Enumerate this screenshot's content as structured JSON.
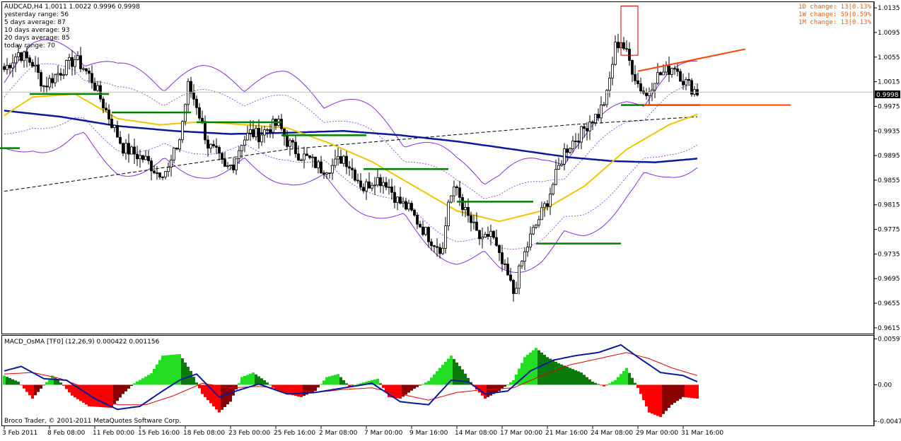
{
  "chart_data": [
    {
      "type": "candlestick",
      "title": "AUDCAD,H4  1.0011 1.0022 0.9996 0.9998",
      "info_lines": [
        "yesterday range: 56",
        "5 days average: 87",
        "10 days average: 93",
        "20 days average: 85",
        "today range: 70"
      ],
      "changes": [
        "1D change: 13|0.13%",
        "1W change: 59|0.59%",
        "1M change: 13|0.13%"
      ],
      "ylim": [
        0.9608,
        1.0142
      ],
      "yticks": [
        "1.0135",
        "1.0095",
        "1.0055",
        "1.0015",
        "0.9975",
        "0.9935",
        "0.9895",
        "0.9855",
        "0.9815",
        "0.9775",
        "0.9735",
        "0.9695",
        "0.9655",
        "0.9615"
      ],
      "current_price": "0.9998",
      "bar_count": 246,
      "anchors": [
        [
          0,
          1.0035
        ],
        [
          5,
          1.0062
        ],
        [
          10,
          1.0045
        ],
        [
          14,
          1.0008
        ],
        [
          18,
          1.0025
        ],
        [
          22,
          1.004
        ],
        [
          25,
          1.0052
        ],
        [
          28,
          1.0038
        ],
        [
          31,
          1.0018
        ],
        [
          34,
          0.9988
        ],
        [
          38,
          0.9948
        ],
        [
          42,
          0.9908
        ],
        [
          46,
          0.9898
        ],
        [
          50,
          0.9888
        ],
        [
          54,
          0.9868
        ],
        [
          58,
          0.9872
        ],
        [
          62,
          0.9922
        ],
        [
          65,
          1.0008
        ],
        [
          68,
          0.9978
        ],
        [
          72,
          0.9912
        ],
        [
          75,
          0.9898
        ],
        [
          78,
          0.9872
        ],
        [
          81,
          0.9882
        ],
        [
          84,
          0.9918
        ],
        [
          87,
          0.9932
        ],
        [
          90,
          0.9928
        ],
        [
          94,
          0.9942
        ],
        [
          97,
          0.9946
        ],
        [
          100,
          0.9918
        ],
        [
          104,
          0.9898
        ],
        [
          108,
          0.9888
        ],
        [
          112,
          0.9874
        ],
        [
          116,
          0.9878
        ],
        [
          120,
          0.9894
        ],
        [
          123,
          0.9872
        ],
        [
          127,
          0.9842
        ],
        [
          131,
          0.9858
        ],
        [
          135,
          0.9852
        ],
        [
          139,
          0.9822
        ],
        [
          143,
          0.9808
        ],
        [
          147,
          0.9782
        ],
        [
          151,
          0.9758
        ],
        [
          155,
          0.9742
        ],
        [
          157,
          0.9822
        ],
        [
          160,
          0.9842
        ],
        [
          163,
          0.9802
        ],
        [
          166,
          0.9778
        ],
        [
          169,
          0.9752
        ],
        [
          172,
          0.9772
        ],
        [
          175,
          0.9728
        ],
        [
          178,
          0.9698
        ],
        [
          180,
          0.9672
        ],
        [
          183,
          0.9722
        ],
        [
          186,
          0.9762
        ],
        [
          189,
          0.9792
        ],
        [
          192,
          0.9822
        ],
        [
          195,
          0.9862
        ],
        [
          198,
          0.9902
        ],
        [
          201,
          0.9918
        ],
        [
          204,
          0.9932
        ],
        [
          207,
          0.9952
        ],
        [
          210,
          0.9962
        ],
        [
          213,
          0.9992
        ],
        [
          216,
          1.0072
        ],
        [
          218,
          1.0082
        ],
        [
          221,
          1.0048
        ],
        [
          224,
          1.0012
        ],
        [
          227,
          0.9992
        ],
        [
          230,
          1.0022
        ],
        [
          234,
          1.0032
        ],
        [
          237,
          1.0042
        ],
        [
          240,
          1.0018
        ],
        [
          243,
          1.0005
        ],
        [
          245,
          0.9998
        ]
      ],
      "ma_yellow": [
        [
          0,
          0.996
        ],
        [
          10,
          0.999
        ],
        [
          25,
          0.9995
        ],
        [
          40,
          0.9955
        ],
        [
          55,
          0.9945
        ],
        [
          70,
          0.995
        ],
        [
          85,
          0.9945
        ],
        [
          100,
          0.994
        ],
        [
          115,
          0.9915
        ],
        [
          130,
          0.9885
        ],
        [
          145,
          0.9845
        ],
        [
          160,
          0.9805
        ],
        [
          175,
          0.9788
        ],
        [
          190,
          0.9805
        ],
        [
          205,
          0.9845
        ],
        [
          220,
          0.9905
        ],
        [
          235,
          0.9945
        ],
        [
          245,
          0.9962
        ]
      ],
      "ma_blue": [
        [
          0,
          0.9968
        ],
        [
          20,
          0.9958
        ],
        [
          40,
          0.9943
        ],
        [
          60,
          0.9935
        ],
        [
          80,
          0.993
        ],
        [
          100,
          0.9932
        ],
        [
          120,
          0.9935
        ],
        [
          140,
          0.9928
        ],
        [
          160,
          0.9918
        ],
        [
          180,
          0.9905
        ],
        [
          200,
          0.9892
        ],
        [
          215,
          0.9886
        ],
        [
          230,
          0.9884
        ],
        [
          245,
          0.989
        ]
      ],
      "ma_black_dashed": [
        [
          0,
          0.9837
        ],
        [
          100,
          0.9905
        ],
        [
          200,
          0.9945
        ],
        [
          245,
          0.9958
        ]
      ],
      "levels_green": [
        [
          9,
          37,
          0.9995
        ],
        [
          38,
          66,
          0.9965
        ],
        [
          68,
          98,
          0.9949
        ],
        [
          98,
          128,
          0.9928
        ],
        [
          127,
          157,
          0.9873
        ],
        [
          160,
          187,
          0.982
        ],
        [
          188,
          218,
          0.9752
        ],
        [
          218,
          246,
          0.9977
        ]
      ],
      "orange_trend": [
        [
          224,
          1.0032
        ],
        [
          262,
          1.0068
        ]
      ],
      "orange_level": [
        [
          226,
          278,
          0.9977
        ]
      ],
      "red_box": [
        [
          218,
          224,
          1.0138,
          1.0058
        ]
      ]
    },
    {
      "type": "bar",
      "title": "MACD_OsMA [TF0] (12,26,9)  0.000422  0.001156",
      "ylim": [
        -0.0052,
        0.0063
      ],
      "yticks": [
        "0.00597",
        "0.00",
        "-0.00473"
      ],
      "osma_anchors": [
        [
          0,
          0.0012
        ],
        [
          5,
          0.0004
        ],
        [
          10,
          -0.0018
        ],
        [
          13,
          -0.0005
        ],
        [
          17,
          0.0012
        ],
        [
          20,
          0.0003
        ],
        [
          24,
          -0.0014
        ],
        [
          30,
          -0.0028
        ],
        [
          38,
          -0.003
        ],
        [
          42,
          -0.0012
        ],
        [
          46,
          0.0002
        ],
        [
          52,
          0.0015
        ],
        [
          56,
          0.0038
        ],
        [
          62,
          0.004
        ],
        [
          66,
          0.0018
        ],
        [
          70,
          -0.0012
        ],
        [
          76,
          -0.0036
        ],
        [
          80,
          -0.0022
        ],
        [
          84,
          0.001
        ],
        [
          88,
          0.0016
        ],
        [
          92,
          0.0006
        ],
        [
          96,
          -0.0006
        ],
        [
          100,
          -0.0012
        ],
        [
          105,
          -0.0016
        ],
        [
          110,
          -0.0008
        ],
        [
          114,
          0.001
        ],
        [
          118,
          0.0014
        ],
        [
          122,
          -0.0002
        ],
        [
          128,
          0.0004
        ],
        [
          132,
          0.0008
        ],
        [
          136,
          -0.0016
        ],
        [
          140,
          -0.0018
        ],
        [
          145,
          -0.0005
        ],
        [
          150,
          0.0005
        ],
        [
          154,
          0.0022
        ],
        [
          158,
          0.0038
        ],
        [
          162,
          0.002
        ],
        [
          166,
          -0.0002
        ],
        [
          170,
          -0.0018
        ],
        [
          175,
          -0.0008
        ],
        [
          180,
          0.0006
        ],
        [
          184,
          0.0036
        ],
        [
          188,
          0.0048
        ],
        [
          192,
          0.0036
        ],
        [
          196,
          0.0028
        ],
        [
          200,
          0.0022
        ],
        [
          204,
          0.0016
        ],
        [
          208,
          0.0004
        ],
        [
          212,
          -0.0002
        ],
        [
          216,
          0.0006
        ],
        [
          220,
          0.0022
        ],
        [
          224,
          -0.0004
        ],
        [
          228,
          -0.0036
        ],
        [
          232,
          -0.0042
        ],
        [
          236,
          -0.0026
        ],
        [
          240,
          -0.0016
        ],
        [
          245,
          -0.0018
        ]
      ],
      "macd_blue": [
        [
          0,
          0.0018
        ],
        [
          6,
          0.0024
        ],
        [
          14,
          0.0008
        ],
        [
          22,
          0.0006
        ],
        [
          32,
          -0.0018
        ],
        [
          40,
          -0.0032
        ],
        [
          48,
          -0.0028
        ],
        [
          56,
          -0.0008
        ],
        [
          62,
          0.0006
        ],
        [
          68,
          0.0014
        ],
        [
          76,
          -0.0016
        ],
        [
          82,
          -0.0008
        ],
        [
          90,
          0.0001
        ],
        [
          100,
          -0.0012
        ],
        [
          110,
          -0.001
        ],
        [
          120,
          -0.0004
        ],
        [
          130,
          0.0002
        ],
        [
          140,
          -0.0022
        ],
        [
          150,
          -0.0026
        ],
        [
          158,
          0.0006
        ],
        [
          164,
          0.0004
        ],
        [
          170,
          -0.0012
        ],
        [
          178,
          -0.0008
        ],
        [
          186,
          0.0018
        ],
        [
          194,
          0.0032
        ],
        [
          202,
          0.0038
        ],
        [
          210,
          0.0042
        ],
        [
          218,
          0.0052
        ],
        [
          224,
          0.0036
        ],
        [
          232,
          0.0016
        ],
        [
          240,
          0.0012
        ],
        [
          245,
          0.0004
        ]
      ],
      "signal_red": [
        [
          0,
          0.0014
        ],
        [
          10,
          0.0016
        ],
        [
          20,
          0.0008
        ],
        [
          30,
          -0.0006
        ],
        [
          40,
          -0.0026
        ],
        [
          50,
          -0.0026
        ],
        [
          60,
          -0.0014
        ],
        [
          70,
          0.0002
        ],
        [
          80,
          -0.0004
        ],
        [
          90,
          -0.0002
        ],
        [
          100,
          -0.0006
        ],
        [
          110,
          -0.001
        ],
        [
          120,
          -0.0006
        ],
        [
          130,
          -0.0004
        ],
        [
          140,
          -0.0012
        ],
        [
          150,
          -0.002
        ],
        [
          160,
          -0.001
        ],
        [
          170,
          -0.0006
        ],
        [
          180,
          -0.0004
        ],
        [
          190,
          0.0012
        ],
        [
          200,
          0.0026
        ],
        [
          210,
          0.0034
        ],
        [
          220,
          0.0042
        ],
        [
          228,
          0.0034
        ],
        [
          236,
          0.0022
        ],
        [
          245,
          0.0012
        ]
      ]
    }
  ],
  "copyright": "Broco Trader, © 2001-2011 MetaQuotes Software Corp.",
  "xticks": [
    {
      "bar": 0,
      "label": "3 Feb 2011"
    },
    {
      "bar": 16,
      "label": "8 Feb 08:00"
    },
    {
      "bar": 32,
      "label": "11 Feb 00:00"
    },
    {
      "bar": 48,
      "label": "15 Feb 16:00"
    },
    {
      "bar": 64,
      "label": "18 Feb 08:00"
    },
    {
      "bar": 80,
      "label": "23 Feb 00:00"
    },
    {
      "bar": 96,
      "label": "25 Feb 16:00"
    },
    {
      "bar": 112,
      "label": "2 Mar 08:00"
    },
    {
      "bar": 128,
      "label": "7 Mar 00:00"
    },
    {
      "bar": 144,
      "label": "9 Mar 16:00"
    },
    {
      "bar": 160,
      "label": "14 Mar 08:00"
    },
    {
      "bar": 176,
      "label": "17 Mar 00:00"
    },
    {
      "bar": 192,
      "label": "21 Mar 16:00"
    },
    {
      "bar": 208,
      "label": "24 Mar 08:00"
    },
    {
      "bar": 224,
      "label": "29 Mar 00:00"
    },
    {
      "bar": 240,
      "label": "31 Mar 16:00"
    }
  ],
  "colors": {
    "bull": "#ffffff",
    "bear": "#000000",
    "ma_yellow": "#f2c400",
    "ma_blue": "#0a1a9a",
    "bands": "#8a2be2",
    "levels": "#008000",
    "trend": "#ff4500",
    "change_text": "#e06010",
    "osma_up_strong": "#22dd22",
    "osma_up_weak": "#0a7a0a",
    "osma_down_strong": "#ff0000",
    "osma_down_weak": "#8b0000",
    "macd": "#0a1a9a",
    "signal": "#dd0000"
  }
}
